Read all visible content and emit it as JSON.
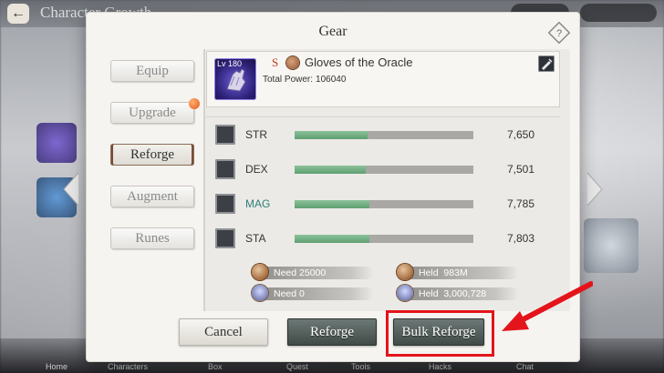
{
  "background": {
    "title": "Character Growth",
    "back_icon": "back-arrow-icon",
    "bottom_tabs": [
      "Home",
      "Characters",
      "Box",
      "Quest",
      "Tools",
      "Hacks",
      "Chat"
    ]
  },
  "modal": {
    "title": "Gear",
    "help_icon": "diamond-help-icon"
  },
  "tabs": [
    {
      "label": "Equip",
      "active": false,
      "notification": false
    },
    {
      "label": "Upgrade",
      "active": false,
      "notification": true
    },
    {
      "label": "Reforge",
      "active": true,
      "notification": false
    },
    {
      "label": "Augment",
      "active": false,
      "notification": false
    },
    {
      "label": "Runes",
      "active": false,
      "notification": false
    }
  ],
  "item": {
    "level": "Lv 180",
    "rank": "S",
    "name": "Gloves of the Oracle",
    "power_label": "Total Power:",
    "power_value": "106040",
    "icon": "gloves-icon"
  },
  "stats": [
    {
      "name": "STR",
      "value": "7,650",
      "fill": 0.41,
      "highlight": false
    },
    {
      "name": "DEX",
      "value": "7,501",
      "fill": 0.4,
      "highlight": false
    },
    {
      "name": "MAG",
      "value": "7,785",
      "fill": 0.42,
      "highlight": true
    },
    {
      "name": "STA",
      "value": "7,803",
      "fill": 0.42,
      "highlight": false
    }
  ],
  "costs": {
    "need_coin": "Need 25000",
    "need_crystal": "Need 0",
    "held_coin": "Held  983M",
    "held_crystal": "Held  3,000,728"
  },
  "buttons": {
    "cancel": "Cancel",
    "reforge": "Reforge",
    "bulk_reforge": "Bulk Reforge"
  },
  "annotation": {
    "color": "#e4141b"
  }
}
